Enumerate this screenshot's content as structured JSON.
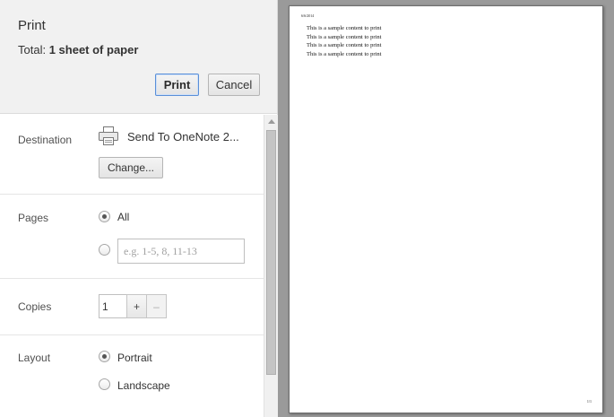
{
  "header": {
    "title": "Print",
    "total_label": "Total:",
    "total_value": "1 sheet of paper",
    "print_label": "Print",
    "cancel_label": "Cancel"
  },
  "destination": {
    "label": "Destination",
    "printer_name": "Send To OneNote 2...",
    "change_label": "Change..."
  },
  "pages": {
    "label": "Pages",
    "all_label": "All",
    "range_placeholder": "e.g. 1-5, 8, 11-13"
  },
  "copies": {
    "label": "Copies",
    "value": "1",
    "plus_label": "+",
    "minus_label": "–"
  },
  "layout": {
    "label": "Layout",
    "portrait_label": "Portrait",
    "landscape_label": "Landscape"
  },
  "preview": {
    "date": "6/6/2014",
    "lines": [
      "This is a sample content to print",
      "This is a sample content to print",
      "This is a sample content to print",
      "This is a sample content to print"
    ],
    "page_number": "1/1"
  },
  "icons": {
    "printer": "printer-icon",
    "scroll_up": "scroll-up-arrow-icon"
  },
  "colors": {
    "header_bg": "#f1f1f1",
    "preview_bg": "#9a9a9a",
    "print_button_border": "#5a8fd8"
  }
}
